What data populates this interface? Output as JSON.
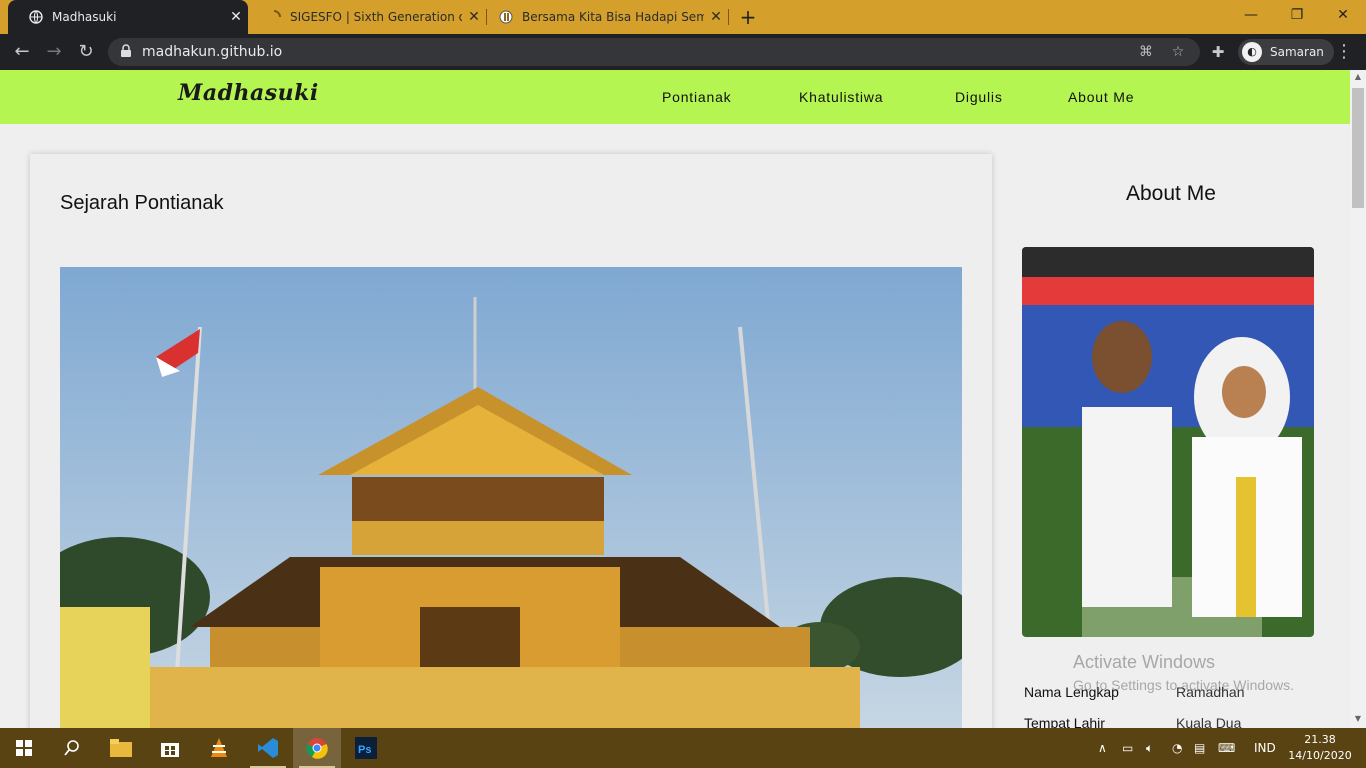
{
  "browser": {
    "tabs": [
      {
        "title": "Madhasuki",
        "active": true,
        "icon": "globe-icon"
      },
      {
        "title": "SIGESFO | Sixth Generation of SIS",
        "active": false,
        "icon": "loading-icon"
      },
      {
        "title": "Bersama Kita Bisa Hadapi Semua",
        "active": false,
        "icon": "site-favicon-icon"
      }
    ],
    "url": "madhakun.github.io",
    "profile_name": "Samaran"
  },
  "site": {
    "logo_text": "Madhasuki",
    "nav": [
      "Pontianak",
      "Khatulistiwa",
      "Digulis",
      "About Me"
    ],
    "nav_bg": "#b5f552"
  },
  "article": {
    "title": "Sejarah Pontianak"
  },
  "sidebar": {
    "title": "About Me",
    "info": [
      {
        "key": "Nama Lengkap",
        "value": "Ramadhan"
      },
      {
        "key": "Tempat Lahir",
        "value": "Kuala Dua"
      }
    ]
  },
  "watermark": {
    "line1": "Activate Windows",
    "line2": "Go to Settings to activate Windows."
  },
  "taskbar": {
    "language": "IND",
    "time": "21.38",
    "date": "14/10/2020",
    "accent": "#5a4313"
  }
}
